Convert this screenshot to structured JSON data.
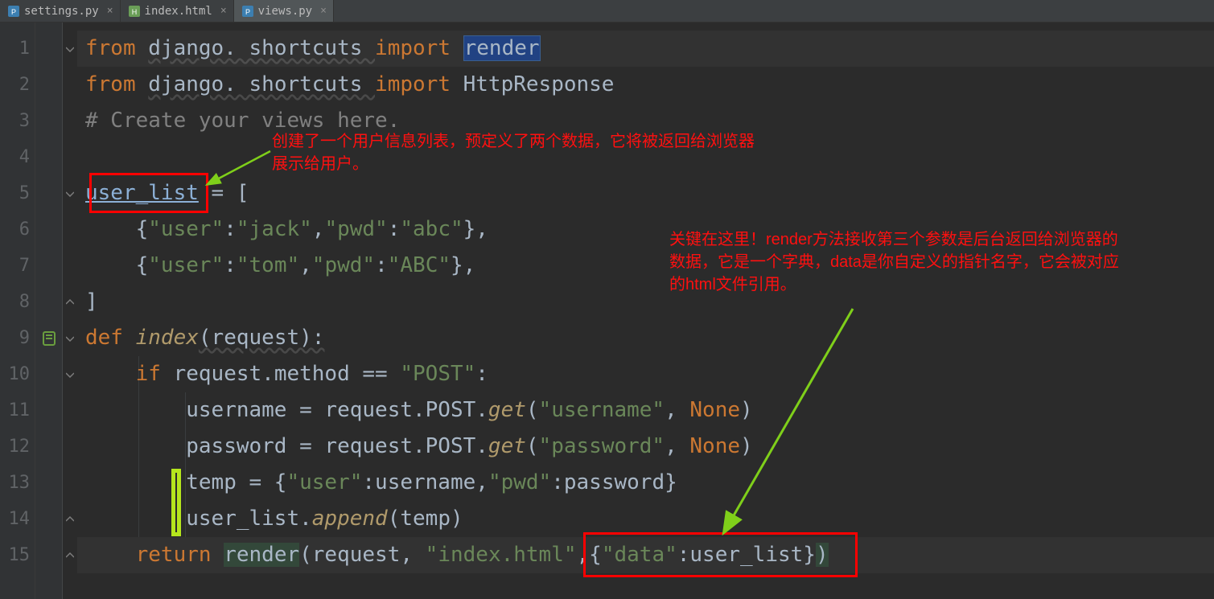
{
  "tabs": {
    "settings": {
      "label": "settings.py"
    },
    "index": {
      "label": "index.html"
    },
    "views": {
      "label": "views.py"
    }
  },
  "gutter": {
    "lines": [
      "1",
      "2",
      "3",
      "4",
      "5",
      "6",
      "7",
      "8",
      "9",
      "10",
      "11",
      "12",
      "13",
      "14",
      "15"
    ]
  },
  "code": {
    "l1": {
      "kw1": "from ",
      "mod": "django. shortcuts ",
      "kw2": "import ",
      "id": "render"
    },
    "l2": {
      "kw1": "from ",
      "mod": "django. shortcuts ",
      "kw2": "import ",
      "id": "HttpResponse"
    },
    "l3": {
      "cmt": "# Create your views here."
    },
    "l4": "",
    "l5": {
      "a": "user_list",
      "b": " = ["
    },
    "l6": {
      "open": "    {",
      "k1": "\"user\"",
      "c1": ":",
      "v1": "\"jack\"",
      "c2": ",",
      "k2": "\"pwd\"",
      "c3": ":",
      "v2": "\"abc\"",
      "close": "},"
    },
    "l7": {
      "open": "    {",
      "k1": "\"user\"",
      "c1": ":",
      "v1": "\"tom\"",
      "c2": ",",
      "k2": "\"pwd\"",
      "c3": ":",
      "v2": "\"ABC\"",
      "close": "},"
    },
    "l8": {
      "txt": "]"
    },
    "l9": {
      "kw": "def ",
      "name": "index",
      "rest": "(request):"
    },
    "l10": {
      "pad": "    ",
      "kw": "if ",
      "a": "request.method == ",
      "s": "\"POST\"",
      "c": ":"
    },
    "l11": {
      "pad": "        ",
      "a": "username = request.POST.",
      "g": "get",
      "p": "(",
      "s": "\"username\"",
      "c": ", ",
      "n": "None",
      "e": ")"
    },
    "l12": {
      "pad": "        ",
      "a": "password = request.POST.",
      "g": "get",
      "p": "(",
      "s": "\"password\"",
      "c": ", ",
      "n": "None",
      "e": ")"
    },
    "l13": {
      "pad": "        ",
      "a": "temp = {",
      "k1": "\"user\"",
      "c1": ":username,",
      "k2": "\"pwd\"",
      "c2": ":password}"
    },
    "l14": {
      "pad": "        ",
      "a": "user_list.",
      "m": "append",
      "p": "(temp)"
    },
    "l15": {
      "pad": "    ",
      "kw": "return ",
      "fn": "render",
      "p1": "(request, ",
      "s1": "\"index.html\"",
      "c1": ",{",
      "s2": "\"data\"",
      "c2": ":user_list}",
      "p2": ")"
    }
  },
  "annotations": {
    "top": "创建了一个用户信息列表，预定义了两个数据，它将被返回给浏览器\n展示给用户。",
    "right": "关键在这里！render方法接收第三个参数是后台返回给浏览器的\n数据，它是一个字典，data是你自定义的指针名字，它会被对应\n的html文件引用。"
  }
}
